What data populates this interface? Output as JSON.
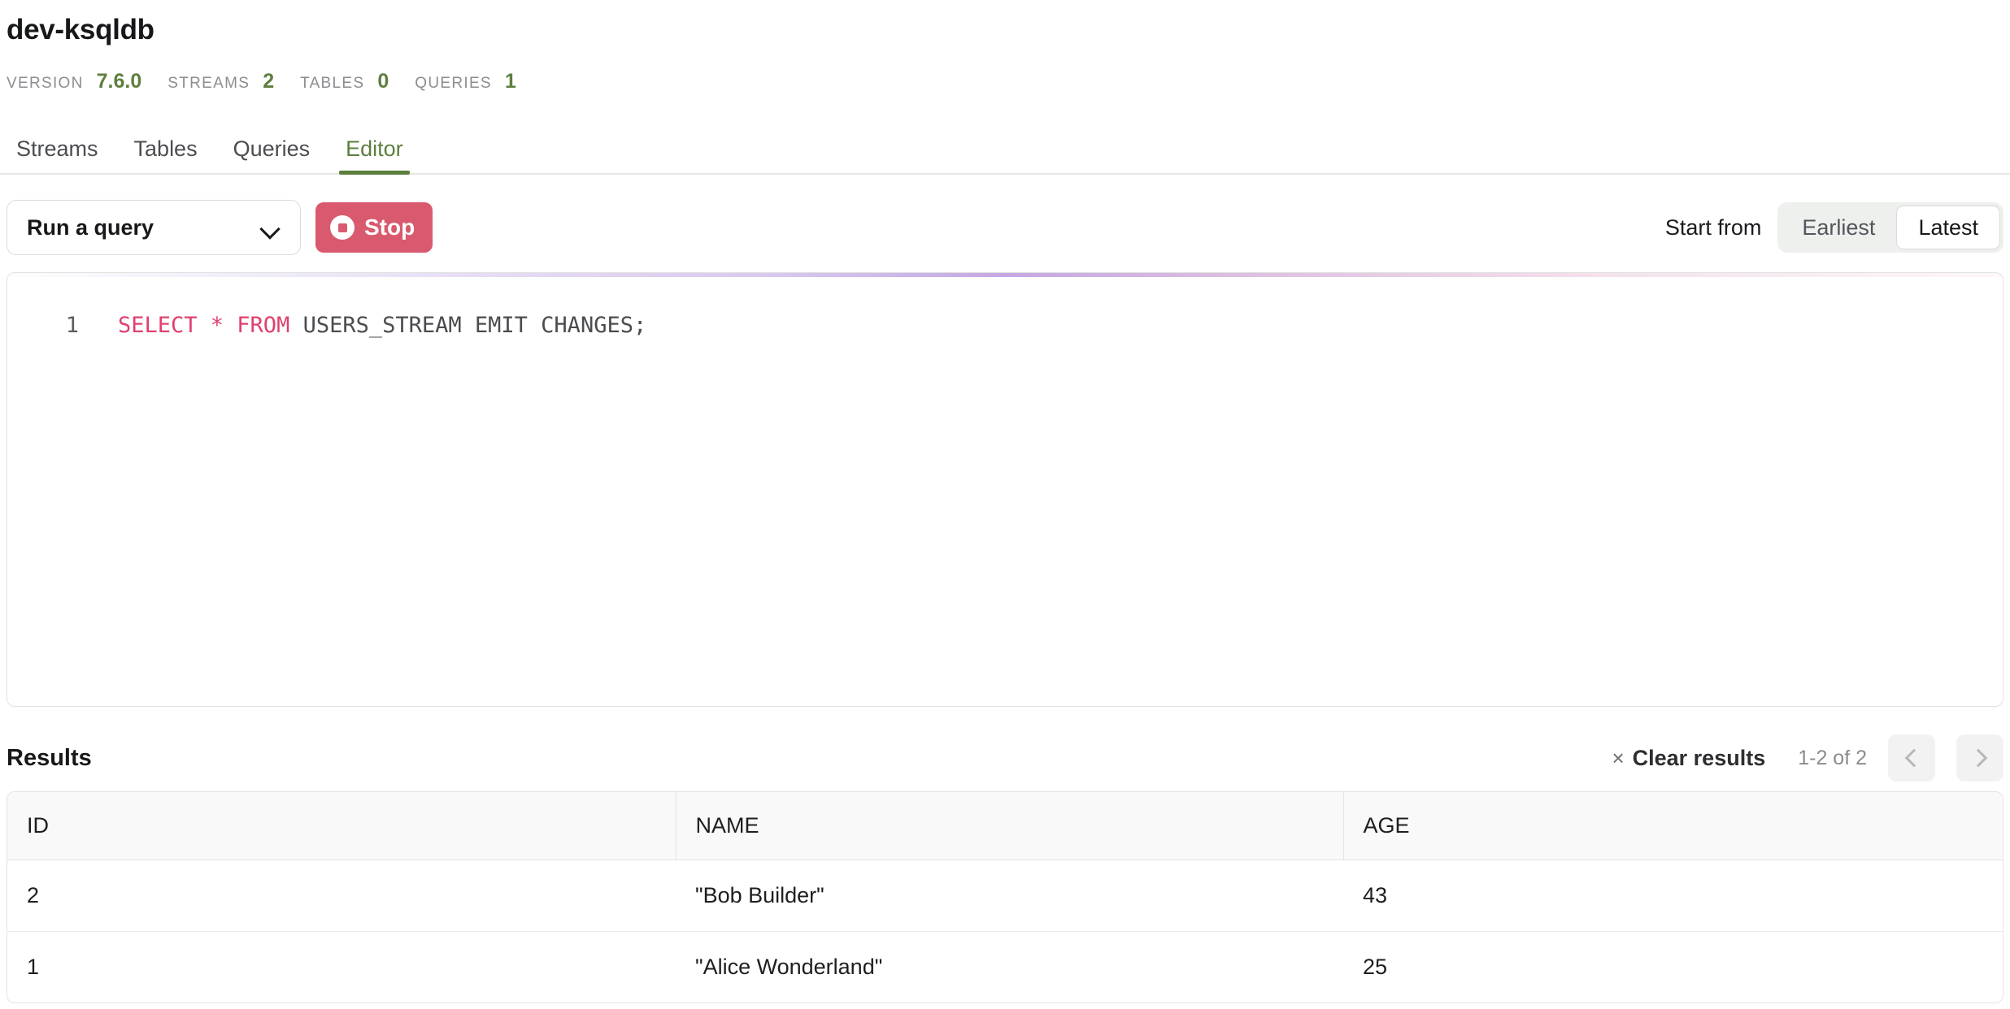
{
  "header": {
    "title": "dev-ksqldb",
    "meta": [
      {
        "label": "VERSION",
        "value": "7.6.0"
      },
      {
        "label": "STREAMS",
        "value": "2"
      },
      {
        "label": "TABLES",
        "value": "0"
      },
      {
        "label": "QUERIES",
        "value": "1"
      }
    ]
  },
  "tabs": [
    {
      "label": "Streams",
      "active": false
    },
    {
      "label": "Tables",
      "active": false
    },
    {
      "label": "Queries",
      "active": false
    },
    {
      "label": "Editor",
      "active": true
    }
  ],
  "toolbar": {
    "query_select_value": "Run a query",
    "chevron_icon": "chevron-down-icon",
    "stop_label": "Stop",
    "stop_icon": "stop-circle-icon",
    "stop_color": "#d95a6e",
    "start_from_label": "Start from",
    "offset_options": [
      {
        "label": "Earliest",
        "active": false
      },
      {
        "label": "Latest",
        "active": true
      }
    ]
  },
  "editor": {
    "line_number": "1",
    "sql_keywords_1": "SELECT * FROM ",
    "sql_rest": "USERS_STREAM EMIT CHANGES;",
    "keyword_color": "#e0406e",
    "running": true
  },
  "results": {
    "title": "Results",
    "clear_label": "Clear results",
    "clear_icon": "close-icon",
    "page_count": "1-2 of 2",
    "prev_icon": "chevron-left-icon",
    "next_icon": "chevron-right-icon",
    "columns": [
      "ID",
      "NAME",
      "AGE"
    ],
    "rows": [
      {
        "id": "2",
        "name": "\"Bob Builder\"",
        "age": "43"
      },
      {
        "id": "1",
        "name": "\"Alice Wonderland\"",
        "age": "25"
      }
    ]
  },
  "theme": {
    "accent_green": "#5d7f3e",
    "danger": "#d95a6e",
    "text": "#17181a",
    "muted": "#8b8d90"
  }
}
